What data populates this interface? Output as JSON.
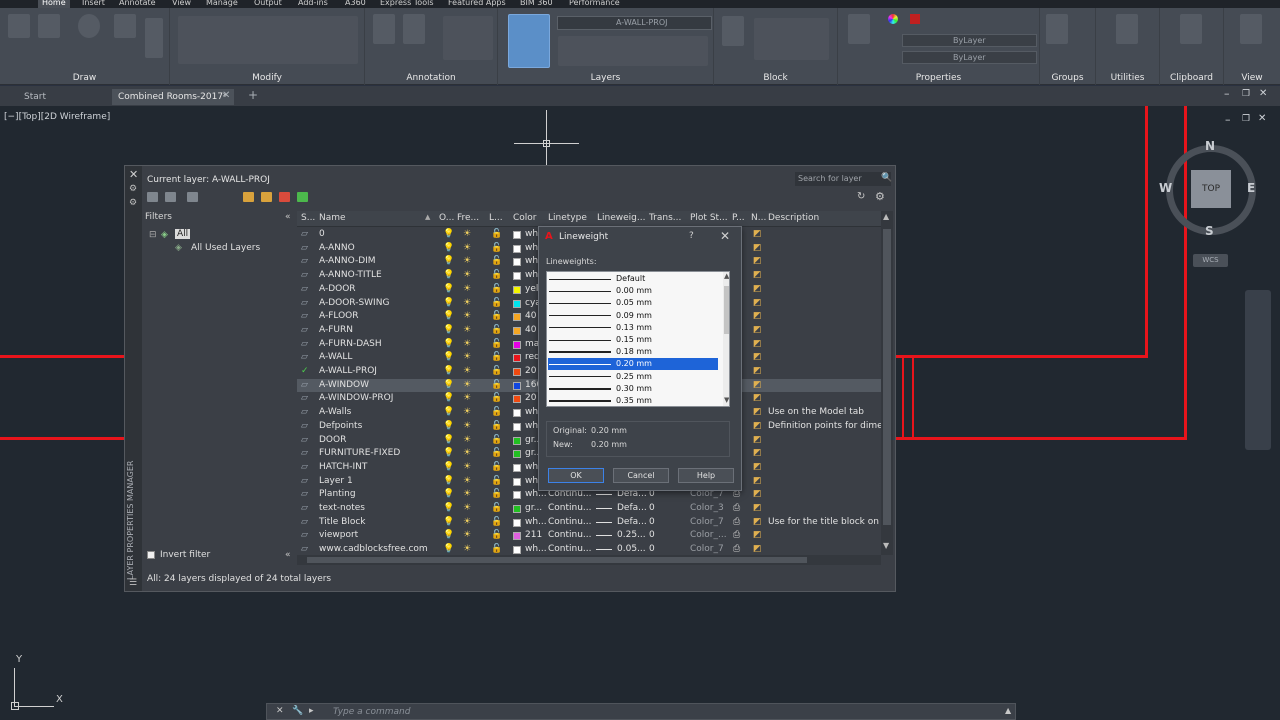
{
  "ribbon": {
    "tabs": [
      "Home",
      "Insert",
      "Annotate",
      "View",
      "Manage",
      "Output",
      "Add-ins",
      "A360",
      "Express Tools",
      "Featured Apps",
      "BIM 360",
      "Performance"
    ],
    "panels": [
      "Draw",
      "Modify",
      "Annotation",
      "Layers",
      "Block",
      "Properties",
      "Groups",
      "Utilities",
      "Clipboard",
      "View"
    ],
    "current_layer": "A-WALL-PROJ",
    "bylayer_1": "ByLayer",
    "bylayer_2": "ByLayer"
  },
  "file_tabs": [
    "Start",
    "Combined Rooms-2017*"
  ],
  "viewport_label": "[−][Top][2D Wireframe]",
  "viewcube": {
    "top": "TOP",
    "n": "N",
    "s": "S",
    "e": "E",
    "w": "W",
    "wcs": "WCS"
  },
  "lpm": {
    "side_title": "LAYER PROPERTIES MANAGER",
    "current_layer": "Current layer: A-WALL-PROJ",
    "search_placeholder": "Search for layer",
    "filters_label": "Filters",
    "tree": [
      "All",
      "All Used Layers"
    ],
    "invert_filter": "Invert filter",
    "status": "All: 24 layers displayed of 24 total layers",
    "columns": [
      "S...",
      "Name",
      "O...",
      "Fre...",
      "L...",
      "Color",
      "Linetype",
      "Lineweig...",
      "Trans...",
      "Plot St...",
      "P...",
      "N...",
      "Description"
    ],
    "layers": [
      {
        "name": "0",
        "color": "wh...",
        "swatch": "#ffffff",
        "linetype": "",
        "lw": "",
        "trans": "",
        "plot": "",
        "desc": ""
      },
      {
        "name": "A-ANNO",
        "color": "wh...",
        "swatch": "#ffffff",
        "linetype": "",
        "lw": "",
        "trans": "",
        "plot": "",
        "desc": ""
      },
      {
        "name": "A-ANNO-DIM",
        "color": "wh...",
        "swatch": "#ffffff",
        "linetype": "",
        "lw": "",
        "trans": "",
        "plot": "",
        "desc": ""
      },
      {
        "name": "A-ANNO-TITLE",
        "color": "wh...",
        "swatch": "#ffffff",
        "linetype": "",
        "lw": "",
        "trans": "",
        "plot": "",
        "desc": ""
      },
      {
        "name": "A-DOOR",
        "color": "yel...",
        "swatch": "#f5f500",
        "linetype": "",
        "lw": "",
        "trans": "",
        "plot": "",
        "desc": ""
      },
      {
        "name": "A-DOOR-SWING",
        "color": "cya...",
        "swatch": "#00e5ee",
        "linetype": "",
        "lw": "",
        "trans": "",
        "plot": "",
        "desc": ""
      },
      {
        "name": "A-FLOOR",
        "color": "40",
        "swatch": "#f5a623",
        "linetype": "",
        "lw": "",
        "trans": "",
        "plot": "",
        "desc": ""
      },
      {
        "name": "A-FURN",
        "color": "40",
        "swatch": "#f5a623",
        "linetype": "",
        "lw": "",
        "trans": "",
        "plot": "",
        "desc": ""
      },
      {
        "name": "A-FURN-DASH",
        "color": "ma...",
        "swatch": "#e600e6",
        "linetype": "",
        "lw": "",
        "trans": "",
        "plot": "",
        "desc": ""
      },
      {
        "name": "A-WALL",
        "color": "red",
        "swatch": "#e8141b",
        "linetype": "",
        "lw": "",
        "trans": "",
        "plot": "",
        "desc": ""
      },
      {
        "name": "A-WALL-PROJ",
        "color": "20",
        "swatch": "#f04a10",
        "linetype": "",
        "lw": "",
        "trans": "",
        "plot": "",
        "desc": ""
      },
      {
        "name": "A-WINDOW",
        "color": "160",
        "swatch": "#1046e0",
        "linetype": "",
        "lw": "",
        "trans": "",
        "plot": "",
        "desc": ""
      },
      {
        "name": "A-WINDOW-PROJ",
        "color": "20",
        "swatch": "#f04a10",
        "linetype": "",
        "lw": "",
        "trans": "",
        "plot": "",
        "desc": ""
      },
      {
        "name": "A-Walls",
        "color": "wh...",
        "swatch": "#ffffff",
        "linetype": "",
        "lw": "",
        "trans": "",
        "plot": "",
        "desc": "Use on the Model tab"
      },
      {
        "name": "Defpoints",
        "color": "wh...",
        "swatch": "#ffffff",
        "linetype": "",
        "lw": "",
        "trans": "",
        "plot": "",
        "desc": "Definition points for dimer"
      },
      {
        "name": "DOOR",
        "color": "gr...",
        "swatch": "#22c022",
        "linetype": "",
        "lw": "",
        "trans": "",
        "plot": "",
        "desc": ""
      },
      {
        "name": "FURNITURE-FIXED",
        "color": "gr...",
        "swatch": "#22c022",
        "linetype": "",
        "lw": "",
        "trans": "",
        "plot": "",
        "desc": ""
      },
      {
        "name": "HATCH-INT",
        "color": "wh...",
        "swatch": "#ffffff",
        "linetype": "",
        "lw": "",
        "trans": "",
        "plot": "",
        "desc": ""
      },
      {
        "name": "Layer 1",
        "color": "wh...",
        "swatch": "#ffffff",
        "linetype": "",
        "lw": "",
        "trans": "",
        "plot": "",
        "desc": ""
      },
      {
        "name": "Planting",
        "color": "wh...",
        "swatch": "#ffffff",
        "linetype": "Continu...",
        "lw": "Defa...",
        "trans": "0",
        "plot": "Color_7",
        "desc": ""
      },
      {
        "name": "text-notes",
        "color": "gr...",
        "swatch": "#22c022",
        "linetype": "Continu...",
        "lw": "Defa...",
        "trans": "0",
        "plot": "Color_3",
        "desc": ""
      },
      {
        "name": "Title Block",
        "color": "wh...",
        "swatch": "#ffffff",
        "linetype": "Continu...",
        "lw": "Defa...",
        "trans": "0",
        "plot": "Color_7",
        "desc": "Use for the title block on th"
      },
      {
        "name": "viewport",
        "color": "211",
        "swatch": "#e060e0",
        "linetype": "Continu...",
        "lw": "0.25...",
        "trans": "0",
        "plot": "Color_...",
        "desc": ""
      },
      {
        "name": "www.cadblocksfree.com",
        "color": "wh...",
        "swatch": "#ffffff",
        "linetype": "Continu...",
        "lw": "0.05...",
        "trans": "0",
        "plot": "Color_7",
        "desc": ""
      }
    ]
  },
  "lineweight_dialog": {
    "title": "Lineweight",
    "help_glyph": "?",
    "list_label": "Lineweights:",
    "items": [
      "Default",
      "0.00 mm",
      "0.05 mm",
      "0.09 mm",
      "0.13 mm",
      "0.15 mm",
      "0.18 mm",
      "0.20 mm",
      "0.25 mm",
      "0.30 mm",
      "0.35 mm"
    ],
    "selected": "0.20 mm",
    "original_label": "Original:",
    "original_value": "0.20 mm",
    "new_label": "New:",
    "new_value": "0.20 mm",
    "ok": "OK",
    "cancel": "Cancel",
    "help": "Help"
  },
  "command_line": {
    "placeholder": "Type a command"
  },
  "ucs": {
    "x": "X",
    "y": "Y"
  }
}
